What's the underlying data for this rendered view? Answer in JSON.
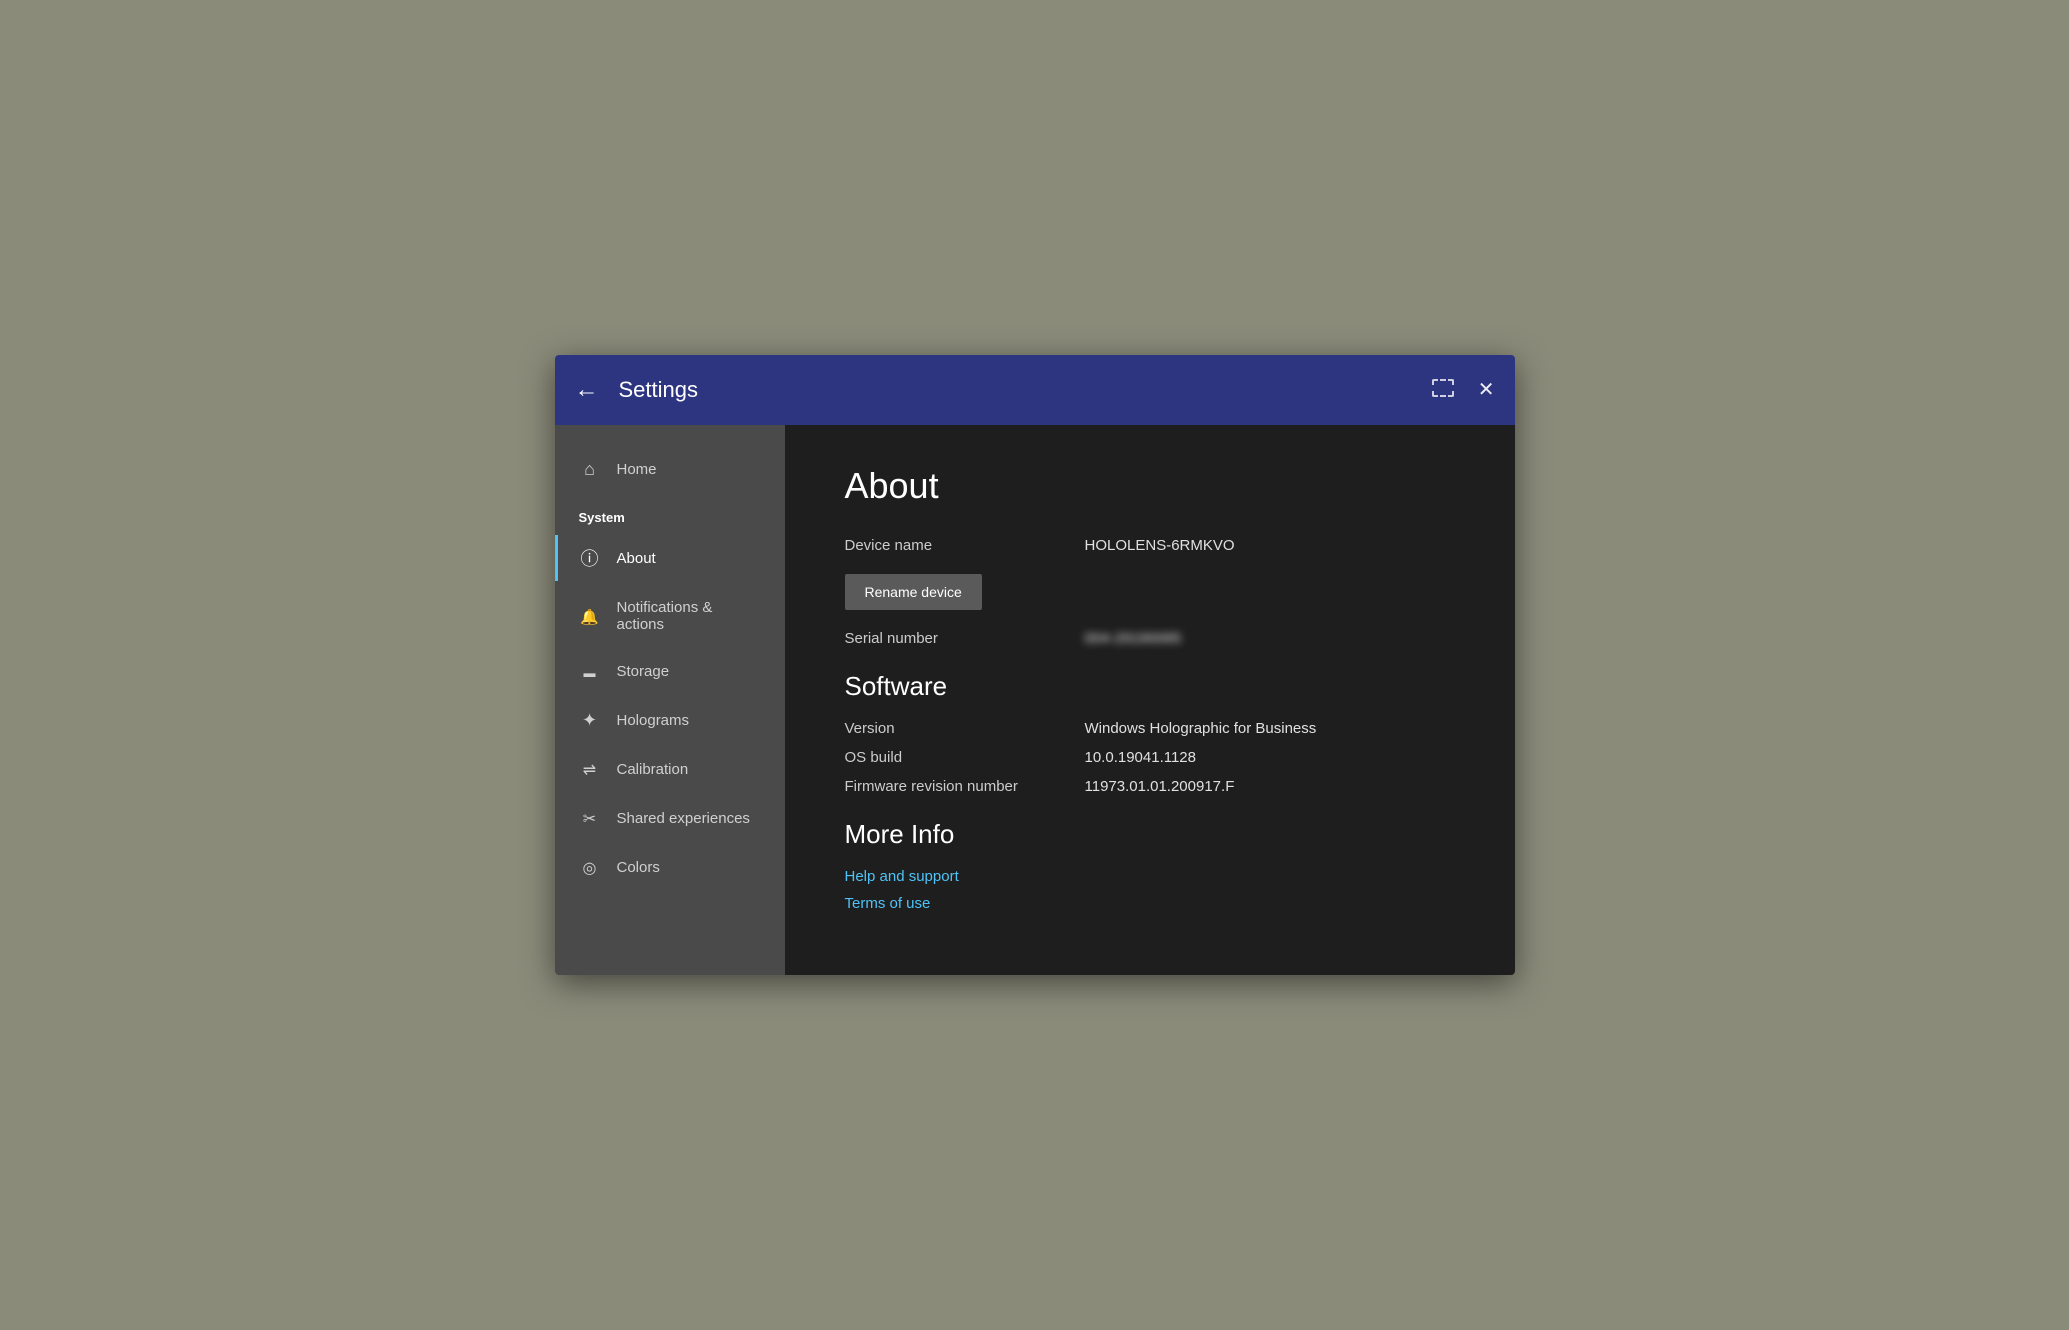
{
  "titlebar": {
    "title": "Settings",
    "back_label": "←",
    "close_label": "✕"
  },
  "sidebar": {
    "home_label": "Home",
    "section_label": "System",
    "items": [
      {
        "id": "about",
        "label": "About",
        "icon": "info",
        "active": true
      },
      {
        "id": "notifications",
        "label": "Notifications & actions",
        "icon": "bell",
        "active": false
      },
      {
        "id": "storage",
        "label": "Storage",
        "icon": "storage",
        "active": false
      },
      {
        "id": "holograms",
        "label": "Holograms",
        "icon": "holograms",
        "active": false
      },
      {
        "id": "calibration",
        "label": "Calibration",
        "icon": "calibration",
        "active": false
      },
      {
        "id": "shared",
        "label": "Shared experiences",
        "icon": "shared",
        "active": false
      },
      {
        "id": "colors",
        "label": "Colors",
        "icon": "colors",
        "active": false
      }
    ]
  },
  "main": {
    "page_title": "About",
    "device_name_label": "Device name",
    "device_name_value": "HOLOLENS-6RMKVO",
    "rename_btn_label": "Rename device",
    "serial_number_label": "Serial number",
    "serial_number_value": "004-29190065",
    "software_title": "Software",
    "version_label": "Version",
    "version_value": "Windows Holographic for Business",
    "os_build_label": "OS build",
    "os_build_value": "10.0.19041.1128",
    "firmware_label": "Firmware revision number",
    "firmware_value": "11973.01.01.200917.F",
    "more_info_title": "More Info",
    "help_link": "Help and support",
    "terms_link": "Terms of use"
  }
}
